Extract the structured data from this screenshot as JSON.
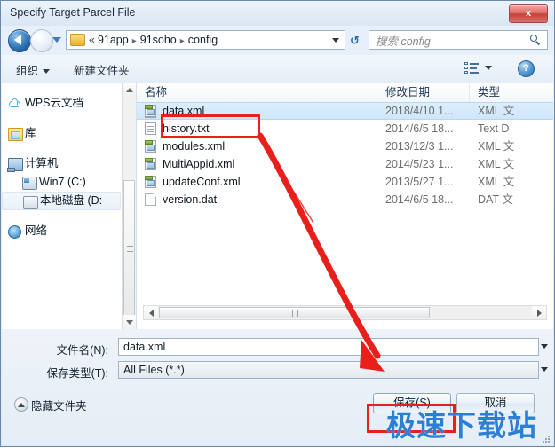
{
  "window": {
    "title": "Specify Target Parcel File",
    "close_label": "x"
  },
  "address_bar": {
    "back_icon": "back-arrow-icon",
    "forward_icon": "forward-arrow-icon",
    "history_dropdown_icon": "chevron-down-icon",
    "folder_icon": "folder-icon",
    "chevron": "«",
    "crumbs": [
      "91app",
      "91soho",
      "config"
    ],
    "separator": "▸",
    "dropdown_icon": "chevron-down-icon",
    "refresh_icon": "refresh-icon",
    "refresh_glyph": "↺"
  },
  "search": {
    "placeholder": "搜索 config",
    "icon": "search-icon"
  },
  "toolbar": {
    "organize_label": "组织",
    "new_folder_label": "新建文件夹",
    "view_icon": "list-view-icon",
    "view_caret_icon": "chevron-down-icon",
    "help_icon": "help-icon",
    "help_label": "?"
  },
  "nav_pane": {
    "items": [
      {
        "label": "WPS云文档",
        "icon": "cloud-icon",
        "indent": false,
        "selected": false
      },
      {
        "label": "库",
        "icon": "library-icon",
        "indent": false,
        "selected": false
      },
      {
        "label": "计算机",
        "icon": "computer-icon",
        "indent": false,
        "selected": false
      },
      {
        "label": "Win7 (C:)",
        "icon": "drive-system-icon",
        "indent": true,
        "selected": false
      },
      {
        "label": "本地磁盘 (D:",
        "icon": "drive-icon",
        "indent": true,
        "selected": true
      },
      {
        "label": "网络",
        "icon": "network-icon",
        "indent": false,
        "selected": false
      }
    ],
    "scrollbar": {
      "up_icon": "scroll-up-icon",
      "down_icon": "scroll-down-icon",
      "thumb": "scroll-thumb"
    }
  },
  "file_list": {
    "columns": [
      "名称",
      "修改日期",
      "类型"
    ],
    "sort_indicator": "sort-ascending-icon",
    "rows": [
      {
        "name": "data.xml",
        "date": "2018/4/10 1...",
        "type": "XML 文",
        "icon": "xml-file-icon",
        "selected": true
      },
      {
        "name": "history.txt",
        "date": "2014/6/5 18...",
        "type": "Text D",
        "icon": "text-file-icon",
        "selected": false
      },
      {
        "name": "modules.xml",
        "date": "2013/12/3 1...",
        "type": "XML 文",
        "icon": "xml-file-icon",
        "selected": false
      },
      {
        "name": "MultiAppid.xml",
        "date": "2014/5/23 1...",
        "type": "XML 文",
        "icon": "xml-file-icon",
        "selected": false
      },
      {
        "name": "updateConf.xml",
        "date": "2013/5/27 1...",
        "type": "XML 文",
        "icon": "xml-file-icon",
        "selected": false
      },
      {
        "name": "version.dat",
        "date": "2014/6/5 18...",
        "type": "DAT 文",
        "icon": "dat-file-icon",
        "selected": false
      }
    ],
    "hscroll": {
      "left_icon": "scroll-left-icon",
      "right_icon": "scroll-right-icon"
    }
  },
  "form": {
    "filename_label": "文件名(N):",
    "filename_value": "data.xml",
    "savetype_label": "保存类型(T):",
    "savetype_value": "All Files (*.*)",
    "dropdown_icon": "chevron-down-icon"
  },
  "footer": {
    "hide_folders_label": "隐藏文件夹",
    "hide_folders_icon": "chevron-up-circle-icon",
    "save_label": "保存(S)",
    "cancel_label": "取消",
    "resize_grip_icon": "resize-grip-icon"
  },
  "annotations": {
    "watermark_text": "极速下载站",
    "highlight_color": "#e8201c",
    "watermark_color": "#2b7fd4"
  }
}
